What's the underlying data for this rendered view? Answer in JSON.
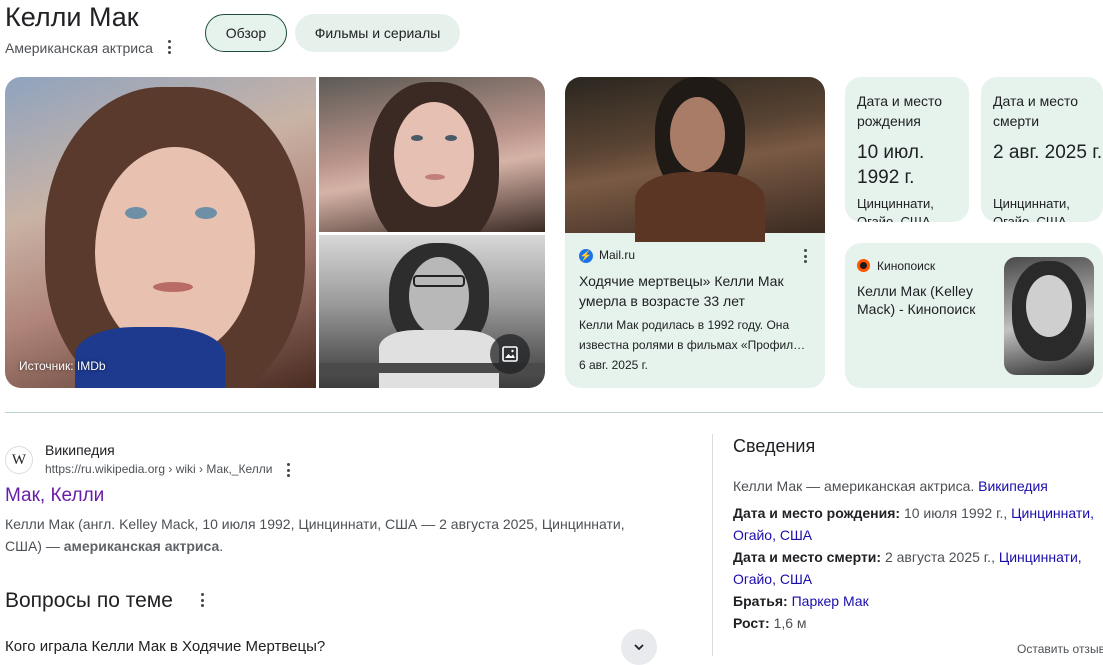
{
  "header": {
    "title": "Келли Мак",
    "subtitle": "Американская актриса",
    "tabs": [
      {
        "label": "Обзор",
        "active": true
      },
      {
        "label": "Фильмы и сериалы",
        "active": false
      }
    ]
  },
  "images": {
    "source_label": "Источник: IMDb"
  },
  "news": {
    "source": "Mail.ru",
    "title": "Ходячие мертвецы» Келли Мак умерла в возрасте 33 лет",
    "snippet": "Келли Мак родилась в 1992 году. Она известна ролями в фильмах «Профил…",
    "date": "6 авг. 2025 г."
  },
  "facts": [
    {
      "label": "Дата и место рождения",
      "value": "10 июл. 1992 г.",
      "place": "Цинциннати, Огайо, США"
    },
    {
      "label": "Дата и место смерти",
      "value": "2 авг. 2025 г.",
      "place": "Цинциннати, Огайо, США"
    }
  ],
  "kinopoisk": {
    "source": "Кинопоиск",
    "title": "Келли Мак (Kelley Mack) - Кинопоиск"
  },
  "result": {
    "site": "Википедия",
    "url": "https://ru.wikipedia.org › wiki › Мак,_Келли",
    "title": "Мак, Келли",
    "snippet_main": "Келли Мак (англ. Kelley Mack, 10 июля 1992, Цинциннати, США — 2 августа 2025, Цинциннати, США) — ",
    "snippet_bold": "американская актриса",
    "snippet_end": "."
  },
  "paa": {
    "title": "Вопросы по теме",
    "questions": [
      "Кого играла Келли Мак в Ходячие Мертвецы?"
    ]
  },
  "info": {
    "title": "Сведения",
    "desc_text": "Келли Мак — американская актриса.",
    "desc_link": "Википедия",
    "birth_label": "Дата и место рождения:",
    "birth_value": "10 июля 1992 г.,",
    "birth_link": "Цинциннати, Огайо, США",
    "death_label": "Дата и место смерти:",
    "death_value": "2 августа 2025 г.,",
    "death_link": "Цинциннати, Огайо, США",
    "siblings_label": "Братья:",
    "siblings_link": "Паркер Мак",
    "height_label": "Рост:",
    "height_value": "1,6 м",
    "feedback": "Оставить отзыв"
  }
}
